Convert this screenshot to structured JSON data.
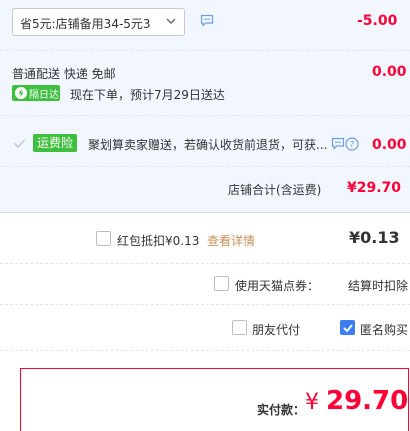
{
  "discount": {
    "select_value": "省5元:店铺备用34-5元3",
    "amount": "-5.00"
  },
  "shipping": {
    "methods": "普通配送 快递 免邮",
    "badge": "隔日达",
    "arrival": "现在下单，预计7月29日送达",
    "amount": "0.00"
  },
  "insurance": {
    "badge": "运费险",
    "description": "聚划算卖家赠送，若确认收货前退货，可获...",
    "amount": "0.00"
  },
  "store_total": {
    "label": "店铺合计(含运费)",
    "amount": "¥29.70"
  },
  "red_packet": {
    "label": "红包抵扣¥0.13",
    "link": "查看详情",
    "amount": "¥0.13"
  },
  "tmall_points": {
    "label": "使用天猫点券：",
    "note": "结算时扣除"
  },
  "friend_pay": {
    "label": "朋友代付"
  },
  "anonymous": {
    "label": "匿名购买"
  },
  "payment": {
    "label": "实付款：",
    "currency": "¥",
    "amount": "29.70"
  },
  "colors": {
    "accent_red": "#ff0036",
    "green": "#3fbf3f",
    "blue_check": "#3d7df0",
    "link_orange": "#c98e5a"
  }
}
